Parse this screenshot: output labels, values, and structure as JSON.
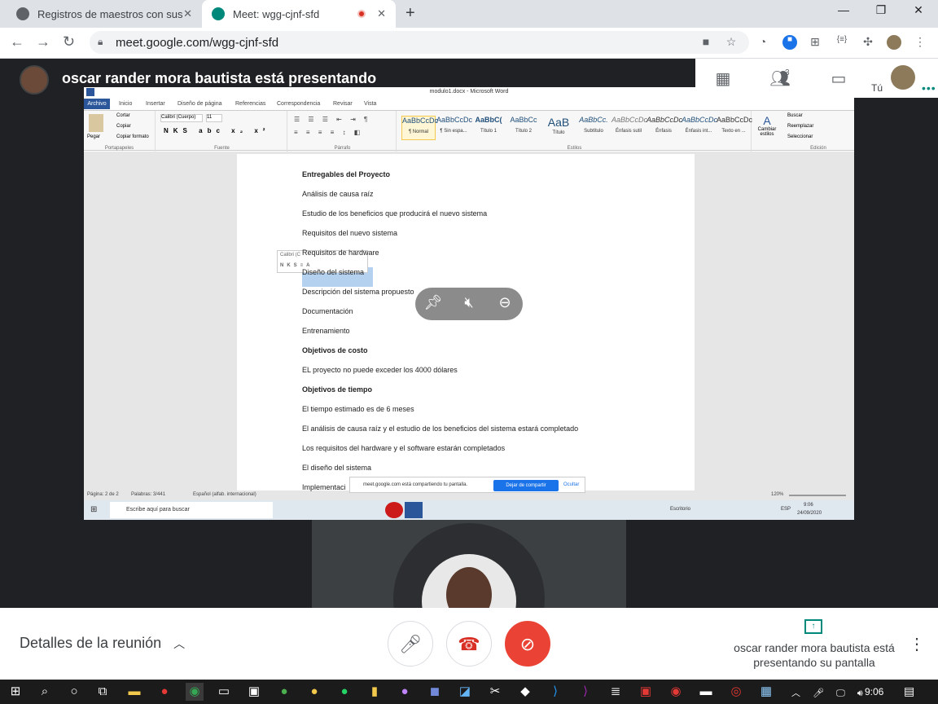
{
  "browser": {
    "tabs": [
      {
        "title": "Registros de maestros con sus co",
        "close": "✕"
      },
      {
        "title": "Meet: wgg-cjnf-sfd",
        "close": "✕"
      }
    ],
    "new_tab": "+",
    "url": "meet.google.com/wgg-cjnf-sfd"
  },
  "meet": {
    "presenter_banner": "oscar rander mora bautista está presentando",
    "participant_count": "3",
    "you_label": "Tú",
    "details_label": "Detalles de la reunión",
    "presenting_info": "oscar rander mora bautista está presentando su pantalla"
  },
  "word": {
    "window_title": "modulo1.docx - Microsoft Word",
    "ribbon_tabs": [
      "Archivo",
      "Inicio",
      "Insertar",
      "Diseño de página",
      "Referencias",
      "Correspondencia",
      "Revisar",
      "Vista"
    ],
    "clipboard": {
      "paste": "Pegar",
      "cut": "Cortar",
      "copy": "Copiar",
      "format": "Copiar formato",
      "group": "Portapapeles"
    },
    "font": {
      "name": "Calibri (Cuerpo)",
      "size": "11",
      "group": "Fuente"
    },
    "paragraph_group": "Párrafo",
    "styles": [
      {
        "sample": "AaBbCcDc",
        "name": "¶ Normal"
      },
      {
        "sample": "AaBbCcDc",
        "name": "¶ Sin espa..."
      },
      {
        "sample": "AaBbC(",
        "name": "Título 1"
      },
      {
        "sample": "AaBbCc",
        "name": "Título 2"
      },
      {
        "sample": "AaB",
        "name": "Título"
      },
      {
        "sample": "AaBbCc.",
        "name": "Subtítulo"
      },
      {
        "sample": "AaBbCcDc",
        "name": "Énfasis sutil"
      },
      {
        "sample": "AaBbCcDc",
        "name": "Énfasis"
      },
      {
        "sample": "AaBbCcDc",
        "name": "Énfasis int..."
      },
      {
        "sample": "AaBbCcDc",
        "name": "Texto en ..."
      }
    ],
    "styles_group": "Estilos",
    "change_styles": "Cambiar estilos",
    "editing": {
      "find": "Buscar",
      "replace": "Reemplazar",
      "select": "Seleccionar",
      "group": "Edición"
    },
    "mini_toolbar_font": "Calibri (C",
    "document_lines": [
      {
        "text": "Entregables del Proyecto",
        "bold": true
      },
      {
        "text": "Análisis de causa raíz",
        "bold": false
      },
      {
        "text": "Estudio de los beneficios que producirá el nuevo sistema",
        "bold": false
      },
      {
        "text": "Requisitos del nuevo sistema",
        "bold": false
      },
      {
        "text": "Requisitos de hardware",
        "bold": false
      },
      {
        "text": "Diseño del sistema",
        "bold": false
      },
      {
        "text": "Descripción del sistema propuesto",
        "bold": false
      },
      {
        "text": "Documentación",
        "bold": false
      },
      {
        "text": "Entrenamiento",
        "bold": false
      },
      {
        "text": "Objetivos de costo",
        "bold": true
      },
      {
        "text": "EL proyecto no puede exceder los 4000 dólares",
        "bold": false
      },
      {
        "text": "Objetivos de tiempo",
        "bold": true
      },
      {
        "text": "El tiempo estimado es de 6 meses",
        "bold": false
      },
      {
        "text": "El análisis de causa raíz y el estudio de los beneficios del sistema estará completado",
        "bold": false
      },
      {
        "text": "Los requisitos del hardware y el software estarán completados",
        "bold": false
      },
      {
        "text": "El diseño del sistema",
        "bold": false
      },
      {
        "text": "Implementaci",
        "bold": false
      }
    ],
    "status": {
      "page": "Página: 2 de 2",
      "words": "Palabras: 3/441",
      "language": "Español (alfab. internacional)",
      "zoom": "120%"
    },
    "share_notice": {
      "text": "meet.google.com está compartiendo tu pantalla.",
      "stop": "Dejar de compartir",
      "hide": "Ocultar"
    },
    "inner_taskbar": {
      "search": "Escribe aquí para buscar",
      "desktop": "Escritorio",
      "lang": "ESP",
      "time": "9:06",
      "date": "24/09/2020"
    }
  },
  "taskbar": {
    "time": "9:06"
  },
  "colors": {
    "meet_bg": "#202124",
    "end_call": "#ea4335",
    "accent": "#1a73e8",
    "word_blue": "#2b579a"
  }
}
